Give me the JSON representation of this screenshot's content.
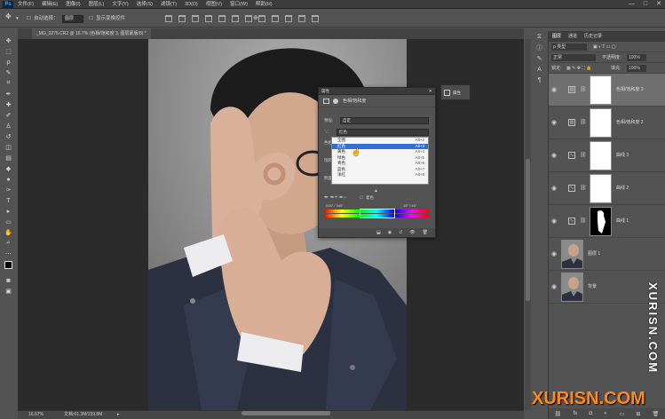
{
  "app": {
    "logo": "Ps"
  },
  "menu": [
    "文件(F)",
    "编辑(E)",
    "图像(I)",
    "图层(L)",
    "文字(Y)",
    "选择(S)",
    "滤镜(T)",
    "3D(D)",
    "视图(V)",
    "窗口(W)",
    "帮助(H)"
  ],
  "window_controls": [
    "—",
    "□",
    "✕"
  ],
  "options_bar": {
    "auto_select_label": "自动选择：",
    "auto_select_value": "图层",
    "show_transform_label": "显示变换控件"
  },
  "document": {
    "tab_label": "_MG_0275.CR2 @ 16.7% (色相/饱和度 3, 图层蒙版/8) *",
    "zoom": "16.67%",
    "doc_size": "文档:61.3M/159.8M"
  },
  "layers_panel": {
    "tabs": [
      "图层",
      "通道",
      "历史记录"
    ],
    "filter_label": "ρ 类型",
    "blend_mode": "正常",
    "opacity_label": "不透明度:",
    "opacity_value": "100%",
    "lock_label": "锁定:",
    "fill_label": "填充:",
    "fill_value": "100%",
    "layers": [
      {
        "name": "色相/饱和度 3",
        "kind": "hue",
        "thumb": "white",
        "selected": true
      },
      {
        "name": "色相/饱和度 2",
        "kind": "hue",
        "thumb": "white",
        "selected": false
      },
      {
        "name": "曲线 3",
        "kind": "curves",
        "thumb": "white",
        "selected": false
      },
      {
        "name": "曲线 2",
        "kind": "curves",
        "thumb": "white",
        "selected": false
      },
      {
        "name": "曲线 1",
        "kind": "curves",
        "thumb": "mask",
        "selected": false
      },
      {
        "name": "图层 1",
        "kind": "photo",
        "thumb": "photo",
        "selected": false
      },
      {
        "name": "背景",
        "kind": "photo",
        "thumb": "photo",
        "selected": false
      }
    ],
    "footer_icons": [
      "link-icon",
      "fx-icon",
      "mask-icon",
      "adjustment-icon",
      "folder-icon",
      "new-layer-icon",
      "trash-icon"
    ]
  },
  "properties_panel": {
    "title": "属性",
    "close": "✕",
    "header_label": "色相/饱和度",
    "preset_label": "预设:",
    "preset_value": "自定",
    "channel_value": "红色",
    "row_hue": "色相",
    "row_sat": "饱和度",
    "row_light": "明度",
    "colorize_label": "着色",
    "range_left": "315° / 345°",
    "range_right": "15° \\ 45°",
    "mini_label": "属性",
    "dropdown": [
      {
        "label": "全图",
        "shortcut": "Alt+2",
        "highlighted": false
      },
      {
        "label": "红色",
        "shortcut": "Alt+3",
        "highlighted": true
      },
      {
        "label": "黄色",
        "shortcut": "Alt+4",
        "highlighted": false
      },
      {
        "label": "绿色",
        "shortcut": "Alt+5",
        "highlighted": false
      },
      {
        "label": "青色",
        "shortcut": "Alt+6",
        "highlighted": false
      },
      {
        "label": "蓝色",
        "shortcut": "Alt+7",
        "highlighted": false
      },
      {
        "label": "洋红",
        "shortcut": "Alt+8",
        "highlighted": false
      }
    ]
  },
  "watermark": {
    "vertical": "XURISN.COM",
    "horizontal": "XURISN.COM"
  },
  "colors": {
    "accent": "#2f6fd6",
    "watermark_orange": "#ff8a16"
  }
}
